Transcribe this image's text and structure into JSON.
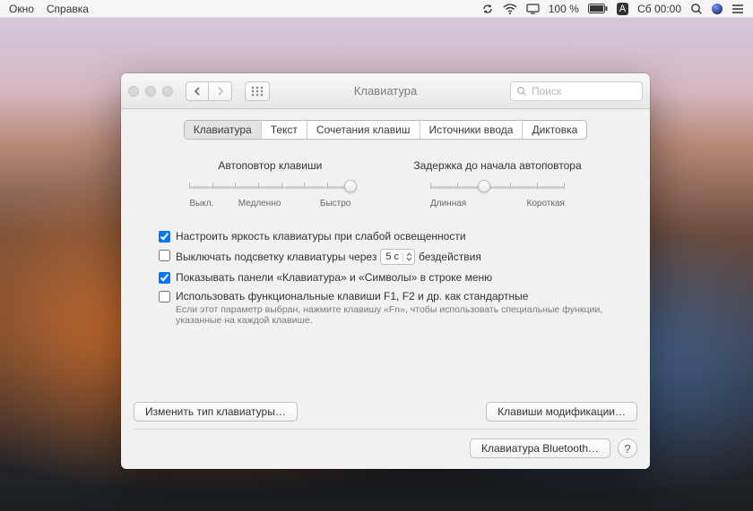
{
  "menubar": {
    "left": [
      "Окно",
      "Справка"
    ],
    "battery": "100 %",
    "lang": "А",
    "datetime": "Сб 00:00"
  },
  "window": {
    "title": "Клавиатура",
    "search_placeholder": "Поиск",
    "tabs": [
      "Клавиатура",
      "Текст",
      "Сочетания клавиш",
      "Источники ввода",
      "Диктовка"
    ],
    "active_tab_index": 0,
    "slider1": {
      "title": "Автоповтор клавиши",
      "labels": [
        "Выкл.",
        "Медленно",
        "Быстро"
      ],
      "ticks": 8,
      "knob_pct": 100
    },
    "slider2": {
      "title": "Задержка до начала автоповтора",
      "labels": [
        "Длинная",
        "Короткая"
      ],
      "ticks": 6,
      "knob_pct": 40
    },
    "options": {
      "o1": {
        "checked": true,
        "label": "Настроить яркость клавиатуры при слабой освещенности"
      },
      "o2": {
        "checked": false,
        "label_pre": "Выключать подсветку клавиатуры через",
        "value": "5 с",
        "label_post": "бездействия"
      },
      "o3": {
        "checked": true,
        "label": "Показывать панели «Клавиатура» и «Символы» в строке меню"
      },
      "o4": {
        "checked": false,
        "label": "Использовать функциональные клавиши F1, F2 и др. как стандартные",
        "hint": "Если этот параметр выбран, нажмите клавишу «Fn», чтобы использовать специальные функции, указанные на каждой клавише."
      }
    },
    "buttons": {
      "change_type": "Изменить тип клавиатуры…",
      "modifiers": "Клавиши модификации…",
      "bluetooth": "Клавиатура Bluetooth…",
      "help": "?"
    }
  }
}
